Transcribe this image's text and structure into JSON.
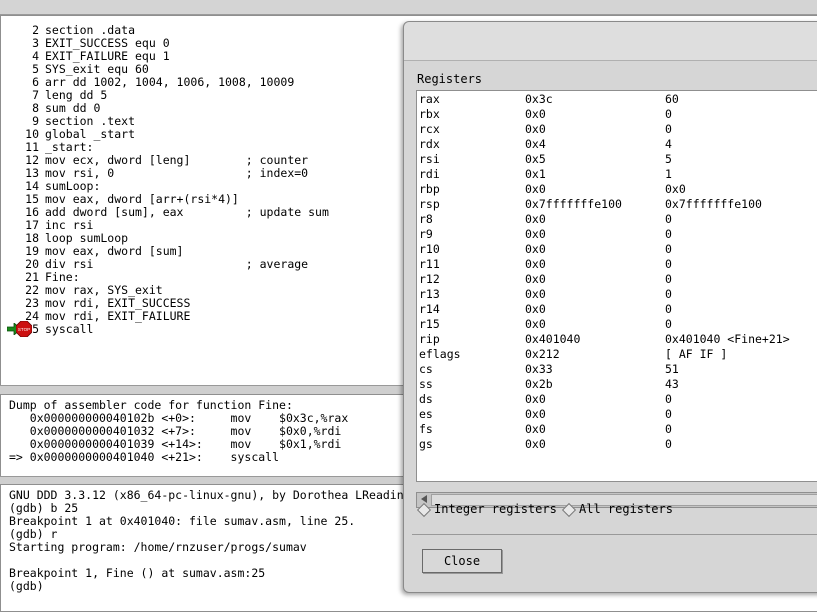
{
  "source": {
    "lines": [
      {
        "num": "2",
        "text": "section .data"
      },
      {
        "num": "3",
        "text": "EXIT_SUCCESS equ 0"
      },
      {
        "num": "4",
        "text": "EXIT_FAILURE equ 1"
      },
      {
        "num": "5",
        "text": "SYS_exit equ 60"
      },
      {
        "num": "6",
        "text": "arr dd 1002, 1004, 1006, 1008, 10009"
      },
      {
        "num": "7",
        "text": "leng dd 5"
      },
      {
        "num": "8",
        "text": "sum dd 0"
      },
      {
        "num": "9",
        "text": "section .text"
      },
      {
        "num": "10",
        "text": "global _start"
      },
      {
        "num": "11",
        "text": "_start:"
      },
      {
        "num": "12",
        "text": "mov ecx, dword [leng]        ; counter"
      },
      {
        "num": "13",
        "text": "mov rsi, 0                   ; index=0"
      },
      {
        "num": "14",
        "text": "sumLoop:"
      },
      {
        "num": "15",
        "text": "mov eax, dword [arr+(rsi*4)]"
      },
      {
        "num": "16",
        "text": "add dword [sum], eax         ; update sum"
      },
      {
        "num": "17",
        "text": "inc rsi"
      },
      {
        "num": "18",
        "text": "loop sumLoop"
      },
      {
        "num": "19",
        "text": "mov eax, dword [sum]"
      },
      {
        "num": "20",
        "text": "div rsi                      ; average"
      },
      {
        "num": "21",
        "text": "Fine:"
      },
      {
        "num": "22",
        "text": "mov rax, SYS_exit"
      },
      {
        "num": "23",
        "text": "mov rdi, EXIT_SUCCESS"
      },
      {
        "num": "24",
        "text": "mov rdi, EXIT_FAILURE"
      },
      {
        "num": "5",
        "text": "syscall"
      }
    ],
    "breakpoint_icon": "stop-icon",
    "pc_icon": "green-arrow-icon"
  },
  "assembler": {
    "lines": [
      "Dump of assembler code for function Fine:",
      "   0x000000000040102b <+0>:     mov    $0x3c,%rax",
      "   0x0000000000401032 <+7>:     mov    $0x0,%rdi",
      "   0x0000000000401039 <+14>:    mov    $0x1,%rdi",
      "=> 0x0000000000401040 <+21>:    syscall"
    ]
  },
  "console": {
    "lines": [
      "GNU DDD 3.3.12 (x86_64-pc-linux-gnu), by Dorothea LReadin",
      "(gdb) b 25",
      "Breakpoint 1 at 0x401040: file sumav.asm, line 25.",
      "(gdb) r",
      "Starting program: /home/rnzuser/progs/sumav",
      "",
      "Breakpoint 1, Fine () at sumav.asm:25",
      "(gdb)"
    ]
  },
  "registers_dialog": {
    "heading": "Registers",
    "rows": [
      {
        "name": "rax",
        "hex": "0x3c",
        "natural": "60"
      },
      {
        "name": "rbx",
        "hex": "0x0",
        "natural": "0"
      },
      {
        "name": "rcx",
        "hex": "0x0",
        "natural": "0"
      },
      {
        "name": "rdx",
        "hex": "0x4",
        "natural": "4"
      },
      {
        "name": "rsi",
        "hex": "0x5",
        "natural": "5"
      },
      {
        "name": "rdi",
        "hex": "0x1",
        "natural": "1"
      },
      {
        "name": "rbp",
        "hex": "0x0",
        "natural": "0x0"
      },
      {
        "name": "rsp",
        "hex": "0x7fffffffe100",
        "natural": "0x7fffffffe100"
      },
      {
        "name": "r8",
        "hex": "0x0",
        "natural": "0"
      },
      {
        "name": "r9",
        "hex": "0x0",
        "natural": "0"
      },
      {
        "name": "r10",
        "hex": "0x0",
        "natural": "0"
      },
      {
        "name": "r11",
        "hex": "0x0",
        "natural": "0"
      },
      {
        "name": "r12",
        "hex": "0x0",
        "natural": "0"
      },
      {
        "name": "r13",
        "hex": "0x0",
        "natural": "0"
      },
      {
        "name": "r14",
        "hex": "0x0",
        "natural": "0"
      },
      {
        "name": "r15",
        "hex": "0x0",
        "natural": "0"
      },
      {
        "name": "rip",
        "hex": "0x401040",
        "natural": "0x401040 <Fine+21>"
      },
      {
        "name": "eflags",
        "hex": "0x212",
        "natural": "[ AF IF ]"
      },
      {
        "name": "cs",
        "hex": "0x33",
        "natural": "51"
      },
      {
        "name": "ss",
        "hex": "0x2b",
        "natural": "43"
      },
      {
        "name": "ds",
        "hex": "0x0",
        "natural": "0"
      },
      {
        "name": "es",
        "hex": "0x0",
        "natural": "0"
      },
      {
        "name": "fs",
        "hex": "0x0",
        "natural": "0"
      },
      {
        "name": "gs",
        "hex": "0x0",
        "natural": "0"
      }
    ],
    "radio_integer": "Integer registers",
    "radio_all": "All registers",
    "close_label": "Close"
  }
}
